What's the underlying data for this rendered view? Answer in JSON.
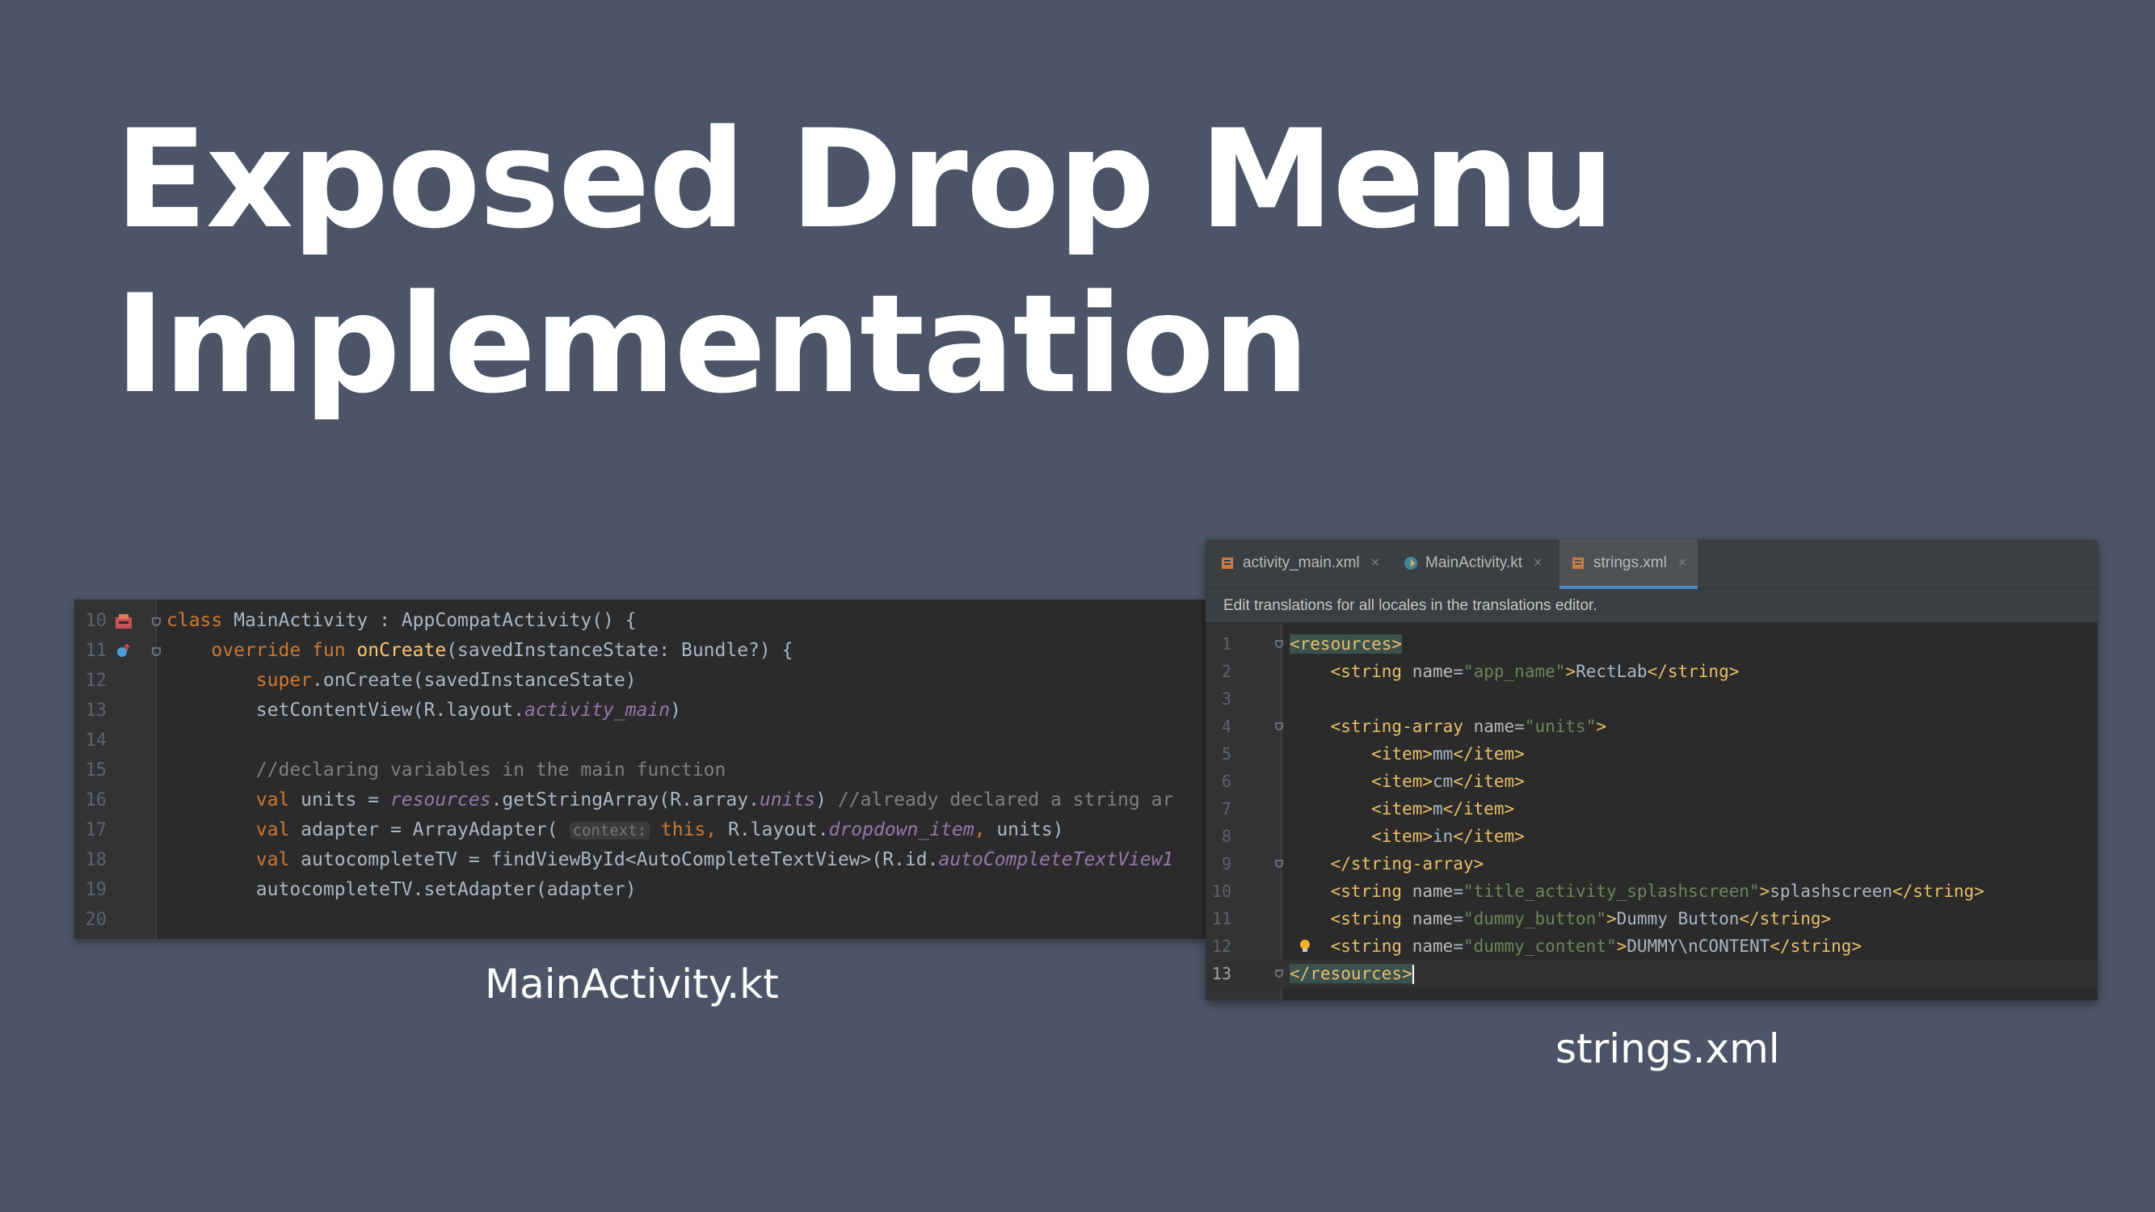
{
  "slide": {
    "title_line1": "Exposed Drop Menu",
    "title_line2": "Implementation",
    "caption_left": "MainActivity.kt",
    "caption_right": "strings.xml"
  },
  "kotlin_editor": {
    "lines": [
      {
        "n": "10",
        "parts": [
          {
            "t": "class ",
            "c": "kw"
          },
          {
            "t": "MainActivity : AppCompatActivity() {",
            "c": ""
          }
        ]
      },
      {
        "n": "11",
        "parts": [
          {
            "t": "    override fun ",
            "c": "kw"
          },
          {
            "t": "onCreate",
            "c": "fn"
          },
          {
            "t": "(savedInstanceState: Bundle?) {",
            "c": ""
          }
        ]
      },
      {
        "n": "12",
        "parts": [
          {
            "t": "        ",
            "c": ""
          },
          {
            "t": "super",
            "c": "kw"
          },
          {
            "t": ".onCreate(savedInstanceState)",
            "c": ""
          }
        ]
      },
      {
        "n": "13",
        "parts": [
          {
            "t": "        setContentView(R.layout.",
            "c": ""
          },
          {
            "t": "activity_main",
            "c": "pv"
          },
          {
            "t": ")",
            "c": ""
          }
        ]
      },
      {
        "n": "14",
        "parts": []
      },
      {
        "n": "15",
        "parts": [
          {
            "t": "        //declaring variables in the main function",
            "c": "cm"
          }
        ]
      },
      {
        "n": "16",
        "parts": [
          {
            "t": "        ",
            "c": ""
          },
          {
            "t": "val ",
            "c": "kw"
          },
          {
            "t": "units = ",
            "c": ""
          },
          {
            "t": "resources",
            "c": "pv"
          },
          {
            "t": ".getStringArray(R.array.",
            "c": ""
          },
          {
            "t": "units",
            "c": "pv"
          },
          {
            "t": ") ",
            "c": ""
          },
          {
            "t": "//already declared a string ar",
            "c": "cm"
          }
        ]
      },
      {
        "n": "17",
        "parts": [
          {
            "t": "        ",
            "c": ""
          },
          {
            "t": "val ",
            "c": "kw"
          },
          {
            "t": "adapter = ArrayAdapter( ",
            "c": ""
          },
          {
            "t": "context:",
            "c": "hint"
          },
          {
            "t": " ",
            "c": ""
          },
          {
            "t": "this",
            "c": "kw"
          },
          {
            "t": ", ",
            "c": "kw"
          },
          {
            "t": "R.layout.",
            "c": ""
          },
          {
            "t": "dropdown_item",
            "c": "pv"
          },
          {
            "t": ", ",
            "c": "kw"
          },
          {
            "t": "units)",
            "c": ""
          }
        ]
      },
      {
        "n": "18",
        "parts": [
          {
            "t": "        ",
            "c": ""
          },
          {
            "t": "val ",
            "c": "kw"
          },
          {
            "t": "autocompleteTV = findViewById<AutoCompleteTextView>(R.id.",
            "c": ""
          },
          {
            "t": "autoCompleteTextView1",
            "c": "pv"
          }
        ]
      },
      {
        "n": "19",
        "parts": [
          {
            "t": "        autocompleteTV.setAdapter(adapter)",
            "c": ""
          }
        ]
      },
      {
        "n": "20",
        "parts": []
      }
    ]
  },
  "xml_editor": {
    "tabs": [
      {
        "label": "activity_main.xml",
        "icon": "xml-layout-icon",
        "active": false
      },
      {
        "label": "MainActivity.kt",
        "icon": "kotlin-class-icon",
        "active": false
      },
      {
        "label": "strings.xml",
        "icon": "xml-values-icon",
        "active": true
      }
    ],
    "close_glyph": "×",
    "notice": "Edit translations for all locales in the translations editor.",
    "lines": [
      {
        "n": "1",
        "parts": [
          {
            "t": "<resources>",
            "c": "tg-hl"
          }
        ]
      },
      {
        "n": "2",
        "parts": [
          {
            "t": "    ",
            "c": ""
          },
          {
            "t": "<string ",
            "c": "tg"
          },
          {
            "t": "name",
            "c": "at"
          },
          {
            "t": "=",
            "c": "tx"
          },
          {
            "t": "\"app_name\"",
            "c": "av"
          },
          {
            "t": ">",
            "c": "tg"
          },
          {
            "t": "RectLab",
            "c": "tx"
          },
          {
            "t": "</string>",
            "c": "tg"
          }
        ]
      },
      {
        "n": "3",
        "parts": []
      },
      {
        "n": "4",
        "parts": [
          {
            "t": "    ",
            "c": ""
          },
          {
            "t": "<string-array ",
            "c": "tg"
          },
          {
            "t": "name",
            "c": "at"
          },
          {
            "t": "=",
            "c": "tx"
          },
          {
            "t": "\"units\"",
            "c": "av"
          },
          {
            "t": ">",
            "c": "tg"
          }
        ]
      },
      {
        "n": "5",
        "parts": [
          {
            "t": "        ",
            "c": ""
          },
          {
            "t": "<item>",
            "c": "tg"
          },
          {
            "t": "mm",
            "c": "tx"
          },
          {
            "t": "</item>",
            "c": "tg"
          }
        ]
      },
      {
        "n": "6",
        "parts": [
          {
            "t": "        ",
            "c": ""
          },
          {
            "t": "<item>",
            "c": "tg"
          },
          {
            "t": "cm",
            "c": "tx"
          },
          {
            "t": "</item>",
            "c": "tg"
          }
        ]
      },
      {
        "n": "7",
        "parts": [
          {
            "t": "        ",
            "c": ""
          },
          {
            "t": "<item>",
            "c": "tg"
          },
          {
            "t": "m",
            "c": "tx"
          },
          {
            "t": "</item>",
            "c": "tg"
          }
        ]
      },
      {
        "n": "8",
        "parts": [
          {
            "t": "        ",
            "c": ""
          },
          {
            "t": "<item>",
            "c": "tg"
          },
          {
            "t": "in",
            "c": "tx"
          },
          {
            "t": "</item>",
            "c": "tg"
          }
        ]
      },
      {
        "n": "9",
        "parts": [
          {
            "t": "    ",
            "c": ""
          },
          {
            "t": "</string-array>",
            "c": "tg"
          }
        ]
      },
      {
        "n": "10",
        "parts": [
          {
            "t": "    ",
            "c": ""
          },
          {
            "t": "<string ",
            "c": "tg"
          },
          {
            "t": "name",
            "c": "at"
          },
          {
            "t": "=",
            "c": "tx"
          },
          {
            "t": "\"title_activity_splashscreen\"",
            "c": "av"
          },
          {
            "t": ">",
            "c": "tg"
          },
          {
            "t": "splashscreen",
            "c": "tx"
          },
          {
            "t": "</string>",
            "c": "tg"
          }
        ]
      },
      {
        "n": "11",
        "parts": [
          {
            "t": "    ",
            "c": ""
          },
          {
            "t": "<string ",
            "c": "tg"
          },
          {
            "t": "name",
            "c": "at"
          },
          {
            "t": "=",
            "c": "tx"
          },
          {
            "t": "\"dummy_button\"",
            "c": "av"
          },
          {
            "t": ">",
            "c": "tg"
          },
          {
            "t": "Dummy Button",
            "c": "tx"
          },
          {
            "t": "</string>",
            "c": "tg"
          }
        ]
      },
      {
        "n": "12",
        "parts": [
          {
            "t": "    ",
            "c": ""
          },
          {
            "t": "<string ",
            "c": "tg"
          },
          {
            "t": "name",
            "c": "at"
          },
          {
            "t": "=",
            "c": "tx"
          },
          {
            "t": "\"dummy_content\"",
            "c": "av"
          },
          {
            "t": ">",
            "c": "tg"
          },
          {
            "t": "DUMMY\\nCONTENT",
            "c": "tx"
          },
          {
            "t": "</string>",
            "c": "tg"
          }
        ]
      },
      {
        "n": "13",
        "parts": [
          {
            "t": "</resources>",
            "c": "tg-hl"
          }
        ]
      }
    ]
  },
  "colors": {
    "background": "#4b5567",
    "editor_bg": "#2b2b2b",
    "keyword": "#cc7832",
    "function": "#ffc66d",
    "comment": "#808080",
    "property": "#9876aa",
    "xml_tag": "#e8bf6a",
    "xml_value": "#6a8759",
    "active_tab_underline": "#4a88c7"
  }
}
